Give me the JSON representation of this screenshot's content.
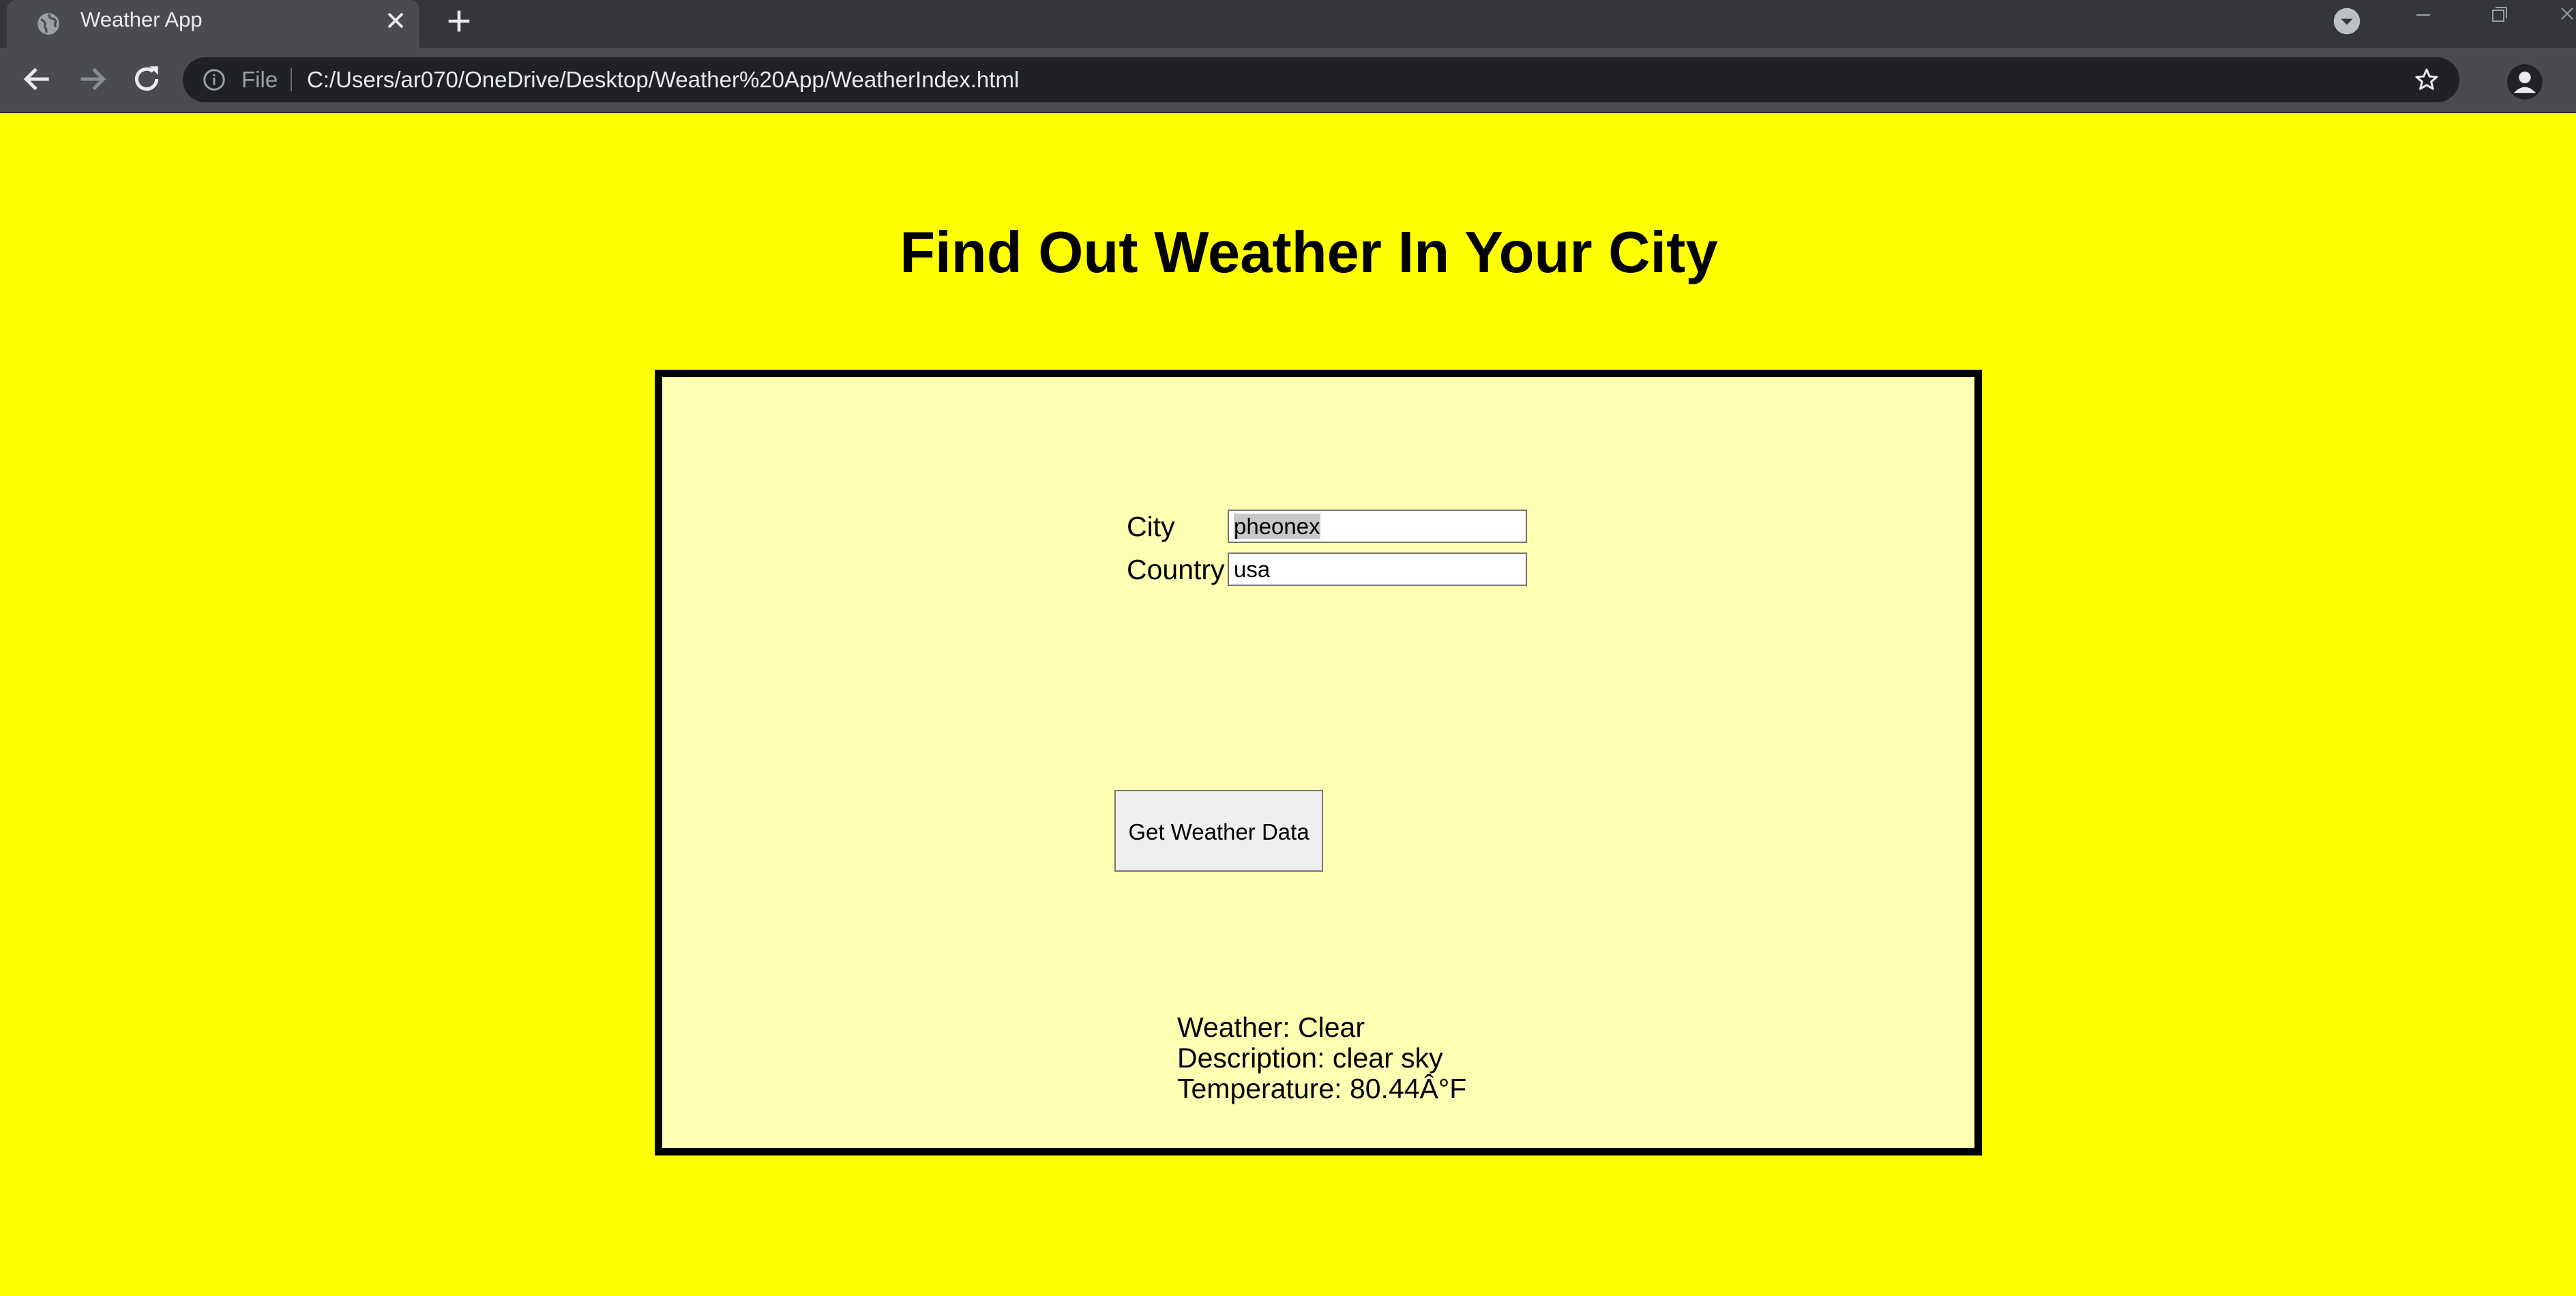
{
  "browser": {
    "tab": {
      "title": "Weather App"
    },
    "omnibox": {
      "scheme_label": "File",
      "url": "C:/Users/ar070/OneDrive/Desktop/Weather%20App/WeatherIndex.html"
    }
  },
  "page": {
    "title": "Find Out Weather In Your City",
    "form": {
      "city_label": "City",
      "city_value": "pheonex",
      "country_label": "Country",
      "country_value": "usa",
      "submit_label": "Get Weather Data"
    },
    "results": {
      "weather": "Weather: Clear",
      "description": "Description: clear sky",
      "temperature": "Temperature: 80.44Â°F"
    }
  },
  "colors": {
    "page_background": "#ffff00",
    "panel_background": "#ffffb3",
    "panel_border": "#000000",
    "chrome_dark": "#35363a",
    "chrome_toolbar": "#4a4b4f"
  },
  "icons": [
    "globe-icon",
    "close-icon",
    "plus-icon",
    "chevron-down-icon",
    "minimize-icon",
    "restore-icon",
    "back-icon",
    "forward-icon",
    "reload-icon",
    "info-icon",
    "star-icon",
    "person-icon"
  ]
}
